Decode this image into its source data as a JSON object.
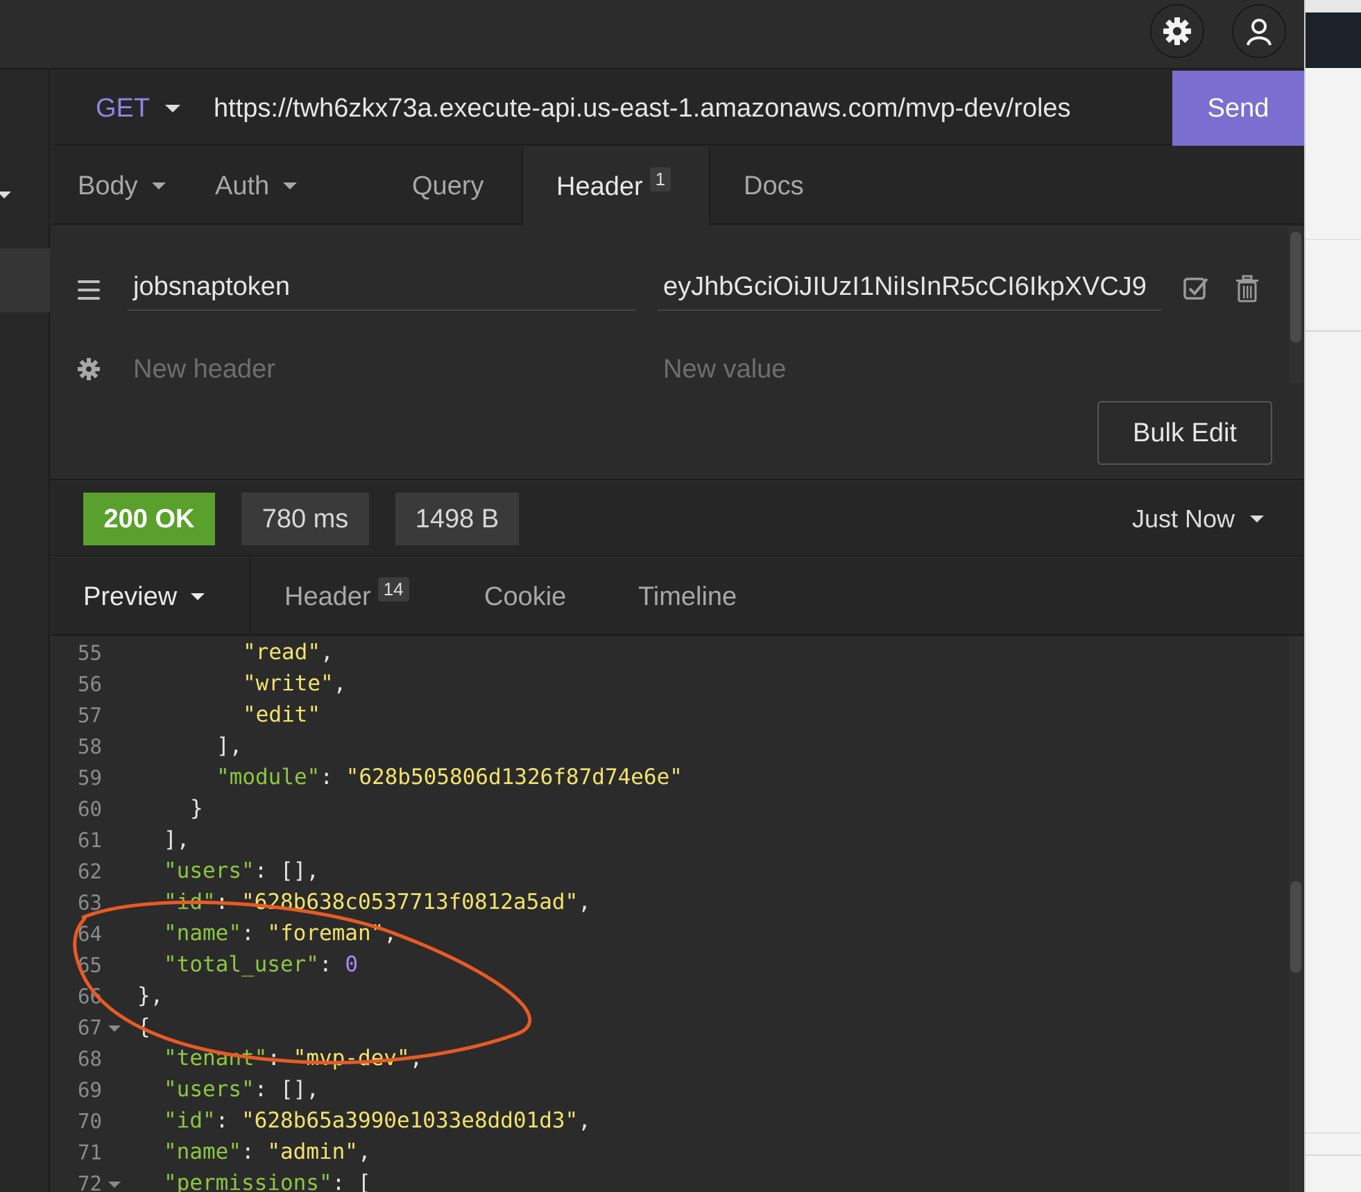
{
  "toolbar": {
    "settings_icon": "gear-icon",
    "account_icon": "user-icon"
  },
  "request": {
    "method": "GET",
    "url": "https://twh6zkx73a.execute-api.us-east-1.amazonaws.com/mvp-dev/roles",
    "send_label": "Send"
  },
  "request_tabs": [
    {
      "label": "Body",
      "has_dropdown": true
    },
    {
      "label": "Auth",
      "has_dropdown": true
    },
    {
      "label": "Query"
    },
    {
      "label": "Header",
      "badge": "1",
      "active": true
    },
    {
      "label": "Docs"
    }
  ],
  "headers": {
    "rows": [
      {
        "name": "jobsnaptoken",
        "value": "eyJhbGciOiJIUzI1NiIsInR5cCI6IkpXVCJ9"
      }
    ],
    "new_name_placeholder": "New header",
    "new_value_placeholder": "New value",
    "bulk_edit_label": "Bulk Edit"
  },
  "response": {
    "status": "200 OK",
    "status_color": "#5aa02c",
    "time": "780 ms",
    "size": "1498 B",
    "history_label": "Just Now"
  },
  "response_tabs": [
    {
      "label": "Preview",
      "has_dropdown": true,
      "active": true
    },
    {
      "label": "Header",
      "badge": "14"
    },
    {
      "label": "Cookie"
    },
    {
      "label": "Timeline"
    }
  ],
  "code_lines": [
    {
      "num": "55",
      "text": "\"read\","
    },
    {
      "num": "56",
      "text": "\"write\","
    },
    {
      "num": "57",
      "text": "\"edit\""
    },
    {
      "num": "58",
      "text": "],"
    },
    {
      "num": "59",
      "text": "\"module\": \"628b505806d1326f87d74e6e\""
    },
    {
      "num": "60",
      "text": "}"
    },
    {
      "num": "61",
      "text": "],"
    },
    {
      "num": "62",
      "text": "\"users\": [],"
    },
    {
      "num": "63",
      "text": "\"id\": \"628b638c0537713f0812a5ad\","
    },
    {
      "num": "64",
      "text": "\"name\": \"foreman\","
    },
    {
      "num": "65",
      "text": "\"total_user\": 0"
    },
    {
      "num": "66",
      "text": "},"
    },
    {
      "num": "67",
      "text": "{"
    },
    {
      "num": "68",
      "text": "\"tenant\": \"mvp-dev\","
    },
    {
      "num": "69",
      "text": "\"users\": [],"
    },
    {
      "num": "70",
      "text": "\"id\": \"628b65a3990e1033e8dd01d3\","
    },
    {
      "num": "71",
      "text": "\"name\": \"admin\","
    },
    {
      "num": "72",
      "text": "\"permissions\": ["
    }
  ],
  "colors": {
    "accent": "#7a6fd0",
    "json_key": "#8ec641",
    "json_string": "#f2e36b",
    "json_number": "#a88bf5",
    "annotation": "#e85a24"
  }
}
